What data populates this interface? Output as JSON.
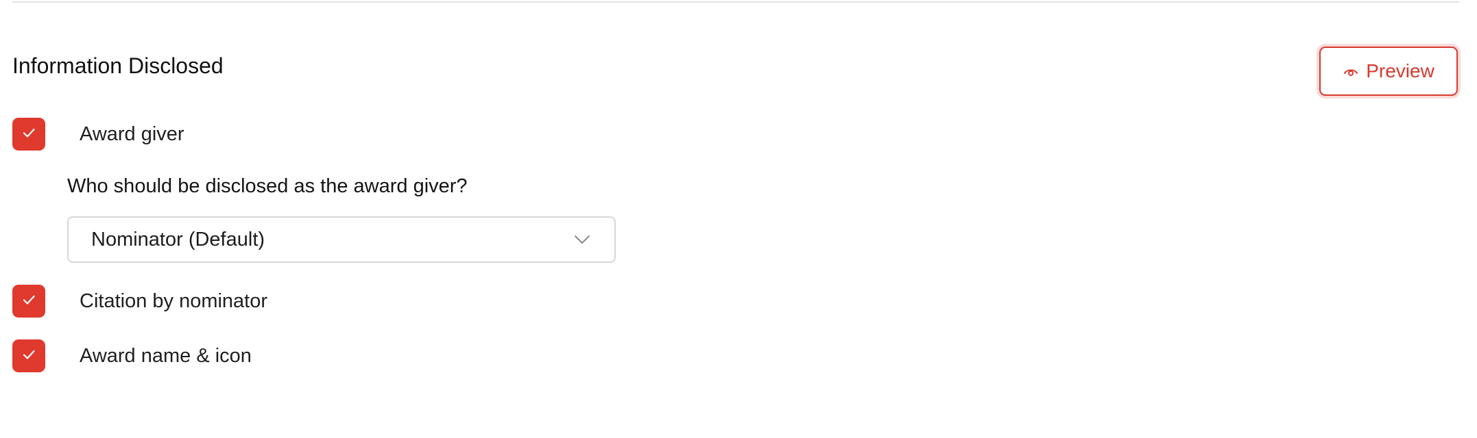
{
  "section": {
    "title": "Information Disclosed",
    "preview_label": "Preview"
  },
  "options": [
    {
      "label": "Award giver",
      "checked": true
    },
    {
      "label": "Citation by nominator",
      "checked": true
    },
    {
      "label": "Award name & icon",
      "checked": true
    }
  ],
  "award_giver": {
    "question": "Who should be disclosed as the award giver?",
    "selected": "Nominator (Default)"
  },
  "colors": {
    "accent": "#e0392d",
    "accent_text": "#d9382c",
    "border": "#d7d7d7",
    "divider": "#e2e2e2"
  },
  "icons": {
    "preview": "eye-icon",
    "checkbox": "checkmark-icon",
    "dropdown": "chevron-down-icon"
  }
}
